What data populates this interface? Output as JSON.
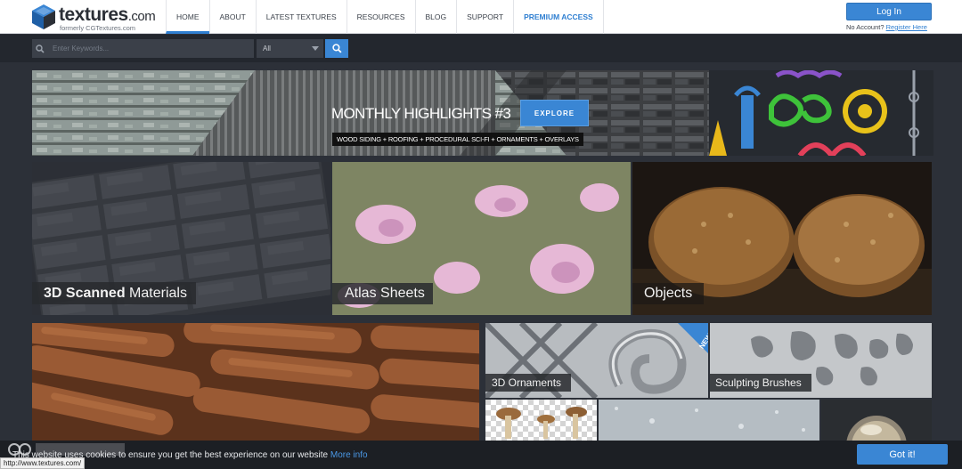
{
  "logo": {
    "name": "textures",
    "domain": ".com",
    "sub": "formerly CGTextures.com"
  },
  "nav": [
    "HOME",
    "ABOUT",
    "LATEST TEXTURES",
    "RESOURCES",
    "BLOG",
    "SUPPORT",
    "PREMIUM ACCESS"
  ],
  "account": {
    "login": "Log In",
    "no_account": "No Account?",
    "register": "Register Here"
  },
  "search": {
    "placeholder": "Enter Keywords...",
    "category": "All"
  },
  "banner": {
    "title": "MONTHLY HIGHLIGHTS #3",
    "subtitle": "WOOD SIDING + ROOFING + PROCEDURAL SCI-FI + ORNAMENTS + OVERLAYS",
    "button": "EXPLORE"
  },
  "categories": {
    "scanned": {
      "bold": "3D Scanned",
      "rest": " Materials"
    },
    "atlas": "Atlas Sheets",
    "objects": "Objects",
    "ornaments": "3D Ornaments",
    "ornaments_badge": "NEW!",
    "brushes": "Sculpting Brushes"
  },
  "cookie": {
    "text": "This website uses cookies to ensure you get the best experience on our website",
    "link": "More info",
    "button": "Got it!"
  },
  "status_url": "http://www.textures.com/",
  "colors": {
    "accent": "#3a86d4",
    "header_bg": "#ffffff",
    "page_bg": "#2c3038",
    "search_bg": "#23272e"
  }
}
